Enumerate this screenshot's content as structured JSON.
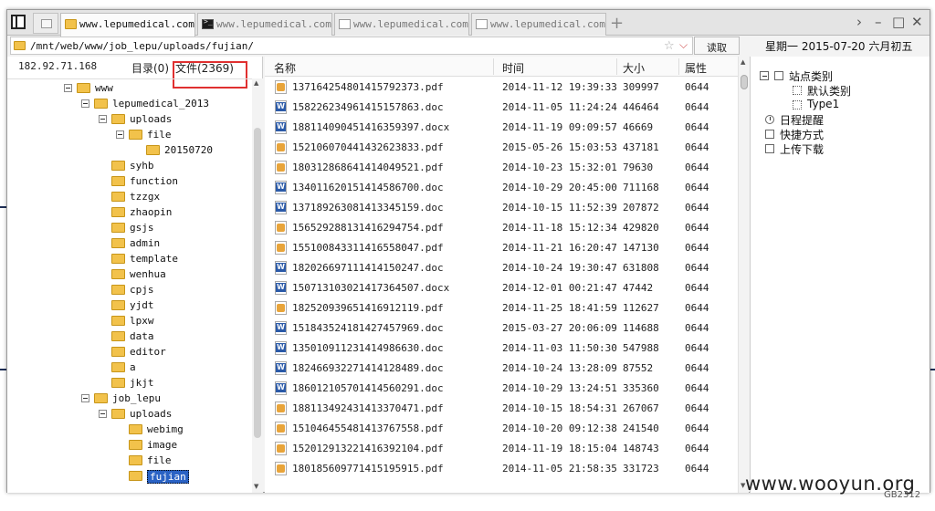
{
  "tabs": [
    {
      "title": "www.lepumedical.com",
      "icon": "folder-icon",
      "active": true
    },
    {
      "title": "www.lepumedical.com",
      "icon": "terminal-icon",
      "active": false
    },
    {
      "title": "www.lepumedical.com",
      "icon": "document-icon",
      "active": false
    },
    {
      "title": "www.lepumedical.com",
      "icon": "document-icon",
      "active": false
    }
  ],
  "tab_add": "+",
  "window_controls": {
    "next": "›",
    "minimize": "–",
    "maximize": "□",
    "close": "✕"
  },
  "address": {
    "path": "/mnt/web/www/job_lepu/uploads/fujian/",
    "star": "☆",
    "dropdown": "⌵",
    "read_button": "读取"
  },
  "date_bar": "星期一  2015-07-20  六月初五",
  "left_pane": {
    "ip": "182.92.71.168",
    "dir_tab": "目录(0)",
    "file_tab": "文件(2369)",
    "tree": [
      {
        "label": "www",
        "depth": 0,
        "expanded": true
      },
      {
        "label": "lepumedical_2013",
        "depth": 1,
        "expanded": true
      },
      {
        "label": "uploads",
        "depth": 2,
        "expanded": true
      },
      {
        "label": "file",
        "depth": 3,
        "expanded": true
      },
      {
        "label": "20150720",
        "depth": 4,
        "expanded": false
      },
      {
        "label": "syhb",
        "depth": 2,
        "expanded": false
      },
      {
        "label": "function",
        "depth": 2,
        "expanded": false
      },
      {
        "label": "tzzgx",
        "depth": 2,
        "expanded": false
      },
      {
        "label": "zhaopin",
        "depth": 2,
        "expanded": false
      },
      {
        "label": "gsjs",
        "depth": 2,
        "expanded": false
      },
      {
        "label": "admin",
        "depth": 2,
        "expanded": false
      },
      {
        "label": "template",
        "depth": 2,
        "expanded": false
      },
      {
        "label": "wenhua",
        "depth": 2,
        "expanded": false
      },
      {
        "label": "cpjs",
        "depth": 2,
        "expanded": false
      },
      {
        "label": "yjdt",
        "depth": 2,
        "expanded": false
      },
      {
        "label": "lpxw",
        "depth": 2,
        "expanded": false
      },
      {
        "label": "data",
        "depth": 2,
        "expanded": false
      },
      {
        "label": "editor",
        "depth": 2,
        "expanded": false
      },
      {
        "label": "a",
        "depth": 2,
        "expanded": false
      },
      {
        "label": "jkjt",
        "depth": 2,
        "expanded": false
      },
      {
        "label": "job_lepu",
        "depth": 1,
        "expanded": true
      },
      {
        "label": "uploads",
        "depth": 2,
        "expanded": true
      },
      {
        "label": "webimg",
        "depth": 3,
        "expanded": false
      },
      {
        "label": "image",
        "depth": 3,
        "expanded": false
      },
      {
        "label": "file",
        "depth": 3,
        "expanded": false
      },
      {
        "label": "fujian",
        "depth": 3,
        "expanded": false,
        "selected": true
      }
    ]
  },
  "file_list": {
    "columns": {
      "name": "名称",
      "time": "时间",
      "size": "大小",
      "attr": "属性"
    },
    "rows": [
      {
        "name": "137164254801415792373.pdf",
        "type": "pdf",
        "time": "2014-11-12 19:39:33",
        "size": "309997",
        "attr": "0644"
      },
      {
        "name": "158226234961415157863.doc",
        "type": "doc",
        "time": "2014-11-05 11:24:24",
        "size": "446464",
        "attr": "0644"
      },
      {
        "name": "188114090451416359397.docx",
        "type": "doc",
        "time": "2014-11-19 09:09:57",
        "size": "46669",
        "attr": "0644"
      },
      {
        "name": "152106070441432623833.pdf",
        "type": "pdf",
        "time": "2015-05-26 15:03:53",
        "size": "437181",
        "attr": "0644"
      },
      {
        "name": "180312868641414049521.pdf",
        "type": "pdf",
        "time": "2014-10-23 15:32:01",
        "size": "79630",
        "attr": "0644"
      },
      {
        "name": "134011620151414586700.doc",
        "type": "doc",
        "time": "2014-10-29 20:45:00",
        "size": "711168",
        "attr": "0644"
      },
      {
        "name": "137189263081413345159.doc",
        "type": "doc",
        "time": "2014-10-15 11:52:39",
        "size": "207872",
        "attr": "0644"
      },
      {
        "name": "156529288131416294754.pdf",
        "type": "pdf",
        "time": "2014-11-18 15:12:34",
        "size": "429820",
        "attr": "0644"
      },
      {
        "name": "155100843311416558047.pdf",
        "type": "pdf",
        "time": "2014-11-21 16:20:47",
        "size": "147130",
        "attr": "0644"
      },
      {
        "name": "182026697111414150247.doc",
        "type": "doc",
        "time": "2014-10-24 19:30:47",
        "size": "631808",
        "attr": "0644"
      },
      {
        "name": "150713103021417364507.docx",
        "type": "doc",
        "time": "2014-12-01 00:21:47",
        "size": "47442",
        "attr": "0644"
      },
      {
        "name": "182520939651416912119.pdf",
        "type": "pdf",
        "time": "2014-11-25 18:41:59",
        "size": "112627",
        "attr": "0644"
      },
      {
        "name": "151843524181427457969.doc",
        "type": "doc",
        "time": "2015-03-27 20:06:09",
        "size": "114688",
        "attr": "0644"
      },
      {
        "name": "135010911231414986630.doc",
        "type": "doc",
        "time": "2014-11-03 11:50:30",
        "size": "547988",
        "attr": "0644"
      },
      {
        "name": "182466932271414128489.doc",
        "type": "doc",
        "time": "2014-10-24 13:28:09",
        "size": "87552",
        "attr": "0644"
      },
      {
        "name": "186012105701414560291.doc",
        "type": "doc",
        "time": "2014-10-29 13:24:51",
        "size": "335360",
        "attr": "0644"
      },
      {
        "name": "188113492431413370471.pdf",
        "type": "pdf",
        "time": "2014-10-15 18:54:31",
        "size": "267067",
        "attr": "0644"
      },
      {
        "name": "151046455481413767558.pdf",
        "type": "pdf",
        "time": "2014-10-20 09:12:38",
        "size": "241540",
        "attr": "0644"
      },
      {
        "name": "152012913221416392104.pdf",
        "type": "pdf",
        "time": "2014-11-19 18:15:04",
        "size": "148743",
        "attr": "0644"
      },
      {
        "name": "180185609771415195915.pdf",
        "type": "pdf",
        "time": "2014-11-05 21:58:35",
        "size": "331723",
        "attr": "0644"
      }
    ]
  },
  "side_panel": {
    "items": [
      {
        "label": "站点类别",
        "level": 0,
        "icon": "collapse-icon"
      },
      {
        "label": "默认类别",
        "level": 1,
        "icon": "category-icon"
      },
      {
        "label": "Type1",
        "level": 1,
        "icon": "category-icon"
      },
      {
        "label": "日程提醒",
        "level": 0,
        "icon": "clock-icon"
      },
      {
        "label": "快捷方式",
        "level": 0,
        "icon": "shortcut-icon"
      },
      {
        "label": "上传下载",
        "level": 0,
        "icon": "transfer-icon"
      }
    ]
  },
  "watermark": "www.wooyun.org",
  "encoding_label": "GB2312",
  "colors": {
    "highlight_box": "#e03030",
    "selection": "#2a62c4",
    "folder": "#f2c24b"
  }
}
